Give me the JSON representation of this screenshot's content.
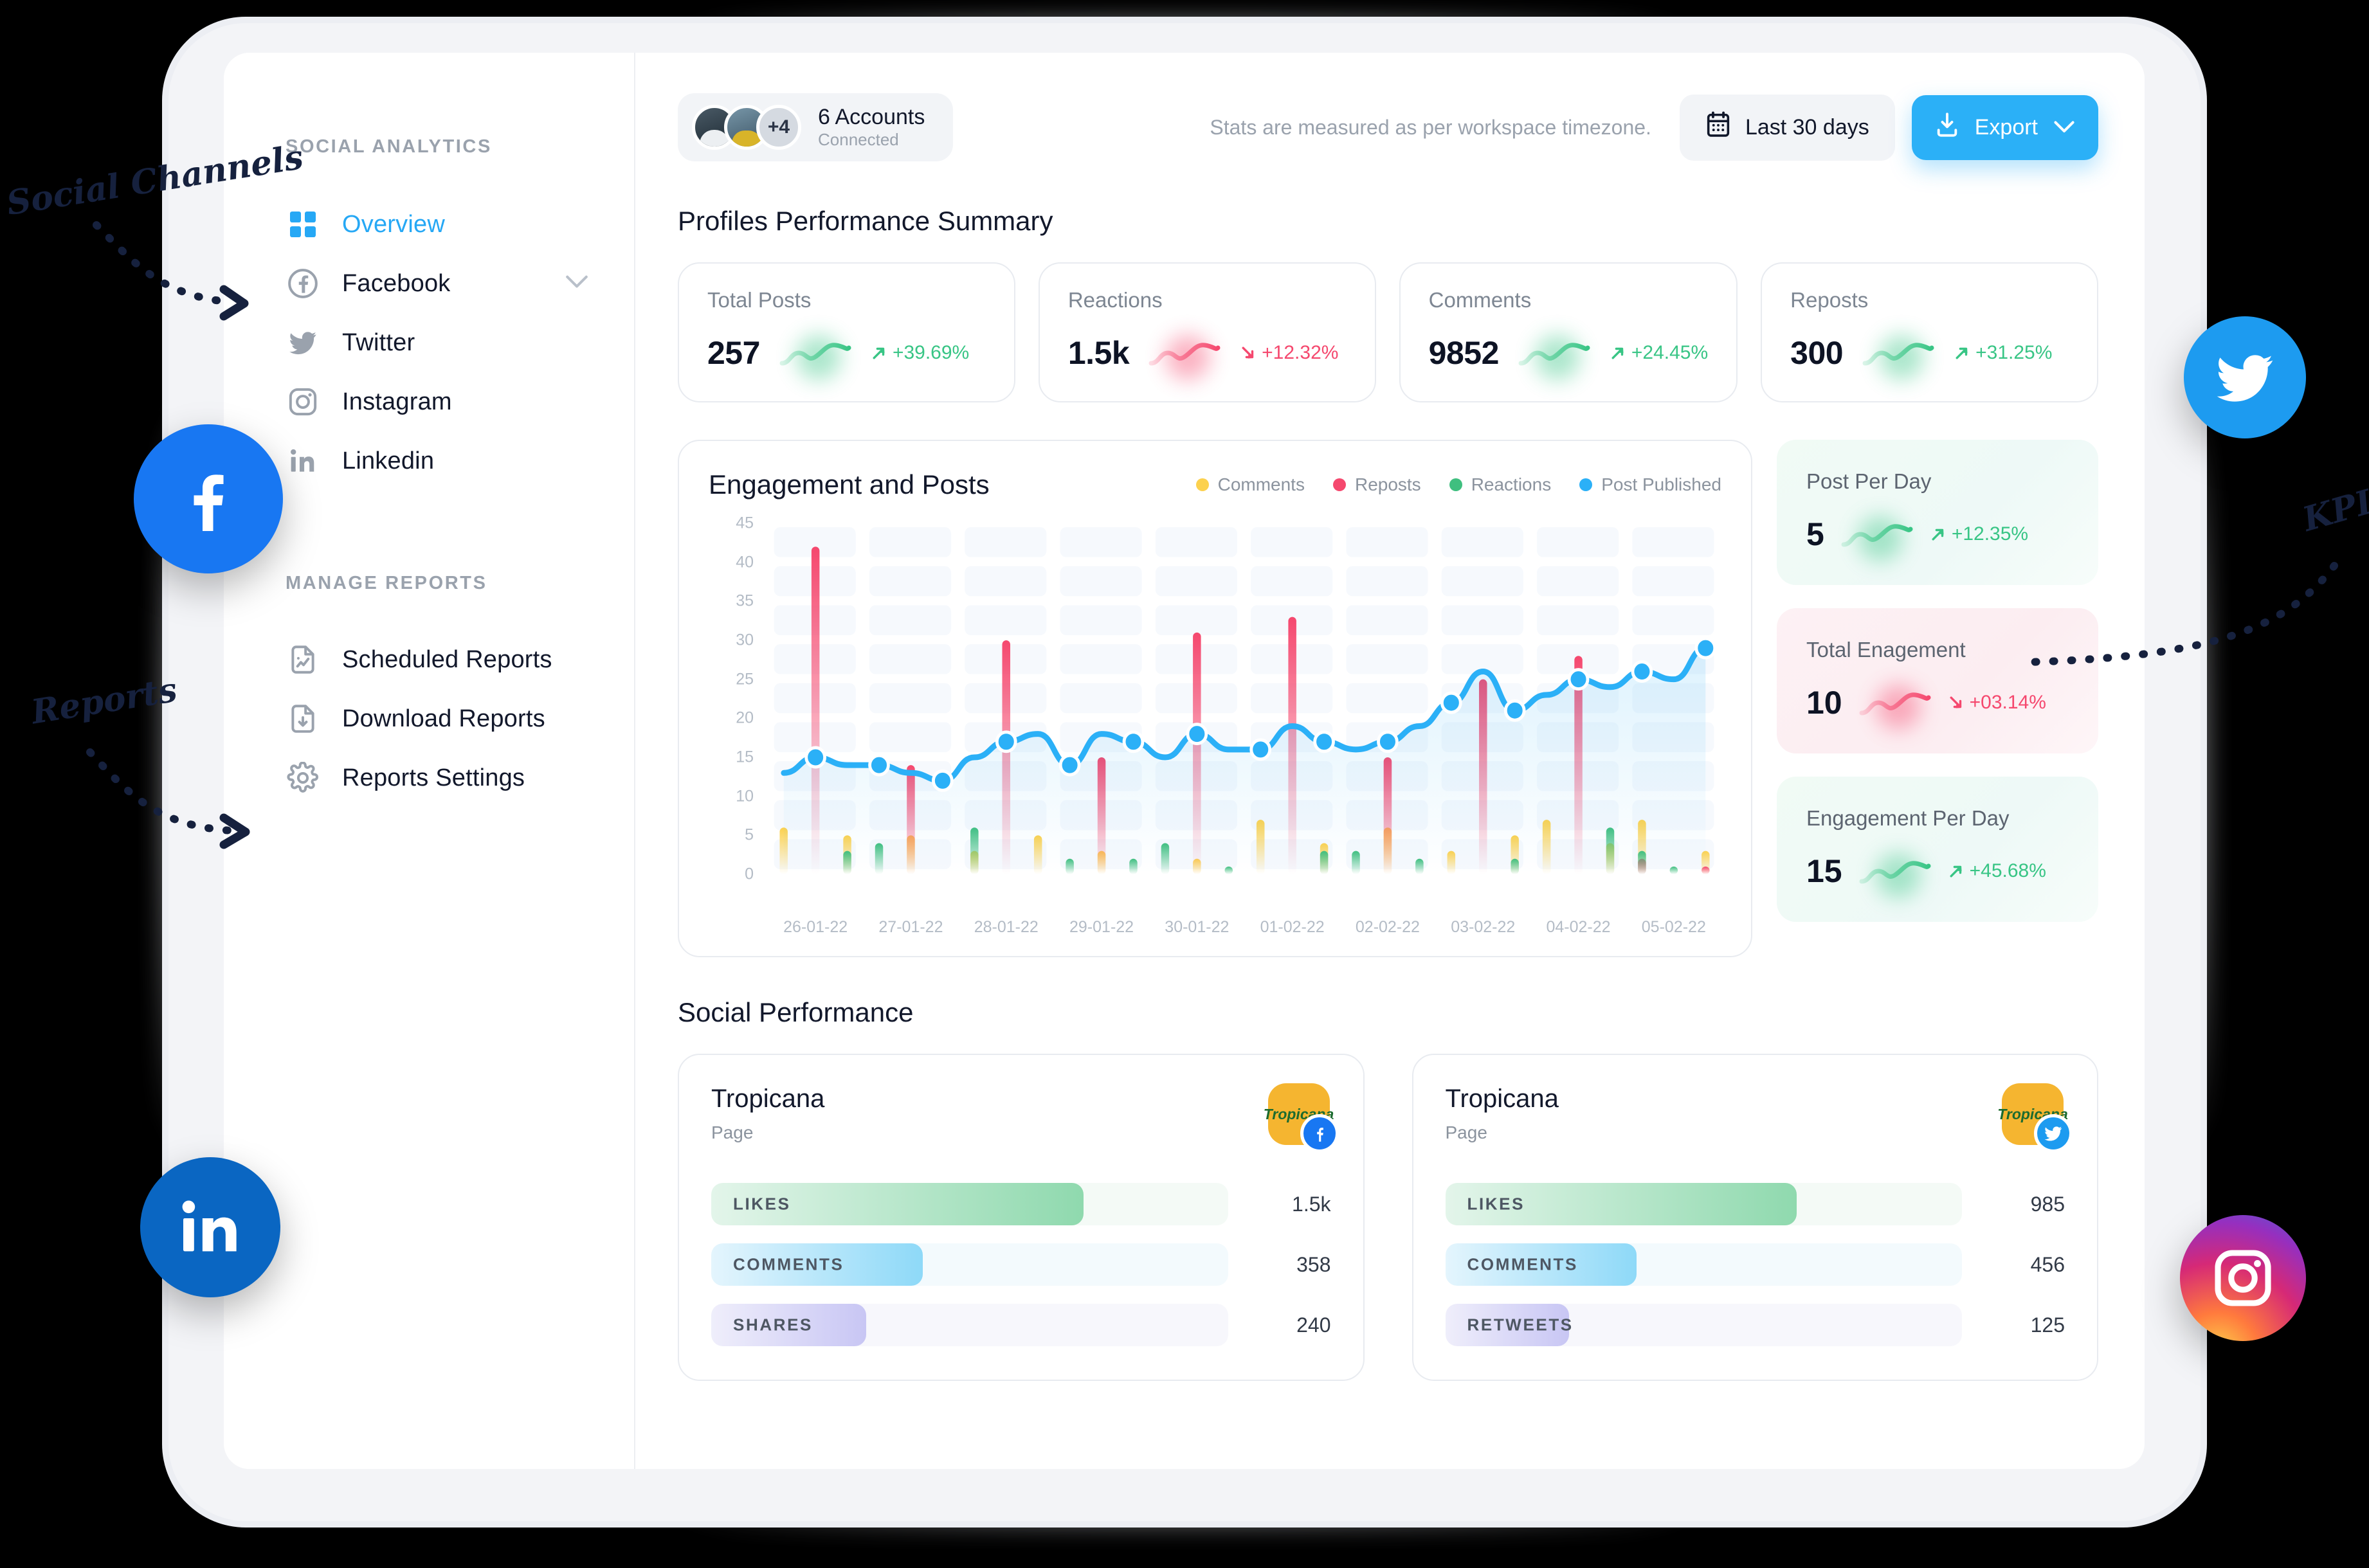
{
  "sidebar": {
    "section_social": "SOCIAL ANALYTICS",
    "section_reports": "MANAGE REPORTS",
    "social_items": [
      {
        "label": "Overview",
        "icon": "grid-icon"
      },
      {
        "label": "Facebook",
        "icon": "facebook-icon"
      },
      {
        "label": "Twitter",
        "icon": "twitter-icon"
      },
      {
        "label": "Instagram",
        "icon": "instagram-icon"
      },
      {
        "label": "Linkedin",
        "icon": "linkedin-icon"
      }
    ],
    "report_items": [
      {
        "label": "Scheduled Reports",
        "icon": "file-chart-icon"
      },
      {
        "label": "Download Reports",
        "icon": "file-download-icon"
      },
      {
        "label": "Reports Settings",
        "icon": "gear-icon"
      }
    ]
  },
  "topbar": {
    "accounts_count": "6 Accounts",
    "accounts_status": "Connected",
    "avatar_more": "+4",
    "timezone_note": "Stats are measured as per workspace timezone.",
    "date_range": "Last 30 days",
    "export_label": "Export"
  },
  "sections": {
    "profiles_summary": "Profiles Performance Summary",
    "social_performance": "Social Performance"
  },
  "kpis": [
    {
      "label": "Total Posts",
      "value": "257",
      "delta": "+39.69%",
      "dir": "up",
      "color": "#38c585"
    },
    {
      "label": "Reactions",
      "value": "1.5k",
      "delta": "+12.32%",
      "dir": "down",
      "color": "#f5486e"
    },
    {
      "label": "Comments",
      "value": "9852",
      "delta": "+24.45%",
      "dir": "up",
      "color": "#38c585"
    },
    {
      "label": "Reposts",
      "value": "300",
      "delta": "+31.25%",
      "dir": "up",
      "color": "#38c585"
    }
  ],
  "rail": [
    {
      "label": "Post Per Day",
      "value": "5",
      "delta": "+12.35%",
      "dir": "up",
      "theme": "green"
    },
    {
      "label": "Total Enagement",
      "value": "10",
      "delta": "+03.14%",
      "dir": "down",
      "theme": "pink"
    },
    {
      "label": "Engagement Per Day",
      "value": "15",
      "delta": "+45.68%",
      "dir": "up",
      "theme": "green"
    }
  ],
  "chart_data": {
    "type": "bar",
    "title": "Engagement and Posts",
    "xlabel": "",
    "ylabel": "",
    "ylim": [
      0,
      45
    ],
    "yticks": [
      0,
      5,
      10,
      15,
      20,
      25,
      30,
      35,
      40,
      45
    ],
    "grid": true,
    "legend_position": "top-right",
    "categories": [
      "26-01-22",
      "27-01-22",
      "28-01-22",
      "29-01-22",
      "30-01-22",
      "01-02-22",
      "02-02-22",
      "03-02-22",
      "04-02-22",
      "05-02-22"
    ],
    "x": [
      "26-01-22",
      "26-01-22",
      "26-01-22",
      "27-01-22",
      "27-01-22",
      "27-01-22",
      "28-01-22",
      "28-01-22",
      "28-01-22",
      "29-01-22",
      "29-01-22",
      "29-01-22",
      "30-01-22",
      "30-01-22",
      "30-01-22",
      "01-02-22",
      "01-02-22",
      "01-02-22",
      "02-02-22",
      "02-02-22",
      "02-02-22",
      "03-02-22",
      "03-02-22",
      "03-02-22",
      "04-02-22",
      "04-02-22",
      "04-02-22",
      "05-02-22",
      "05-02-22",
      "05-02-22"
    ],
    "series": [
      {
        "name": "Comments",
        "color": "#fcd14e",
        "values": [
          6,
          0,
          5,
          0,
          5,
          0,
          3,
          0,
          5,
          0,
          3,
          0,
          0,
          2,
          0,
          7,
          0,
          4,
          0,
          6,
          0,
          3,
          0,
          5,
          7,
          0,
          4,
          7,
          0,
          3
        ]
      },
      {
        "name": "Reposts",
        "color": "#f5486e",
        "values": [
          0,
          42,
          0,
          0,
          14,
          0,
          0,
          30,
          0,
          0,
          15,
          0,
          0,
          31,
          0,
          0,
          33,
          0,
          0,
          15,
          0,
          0,
          25,
          0,
          0,
          28,
          0,
          2,
          0,
          1
        ]
      },
      {
        "name": "Reactions",
        "color": "#3fbf7f",
        "values": [
          0,
          0,
          3,
          4,
          0,
          0,
          6,
          0,
          0,
          2,
          0,
          2,
          4,
          0,
          1,
          0,
          0,
          3,
          3,
          0,
          2,
          0,
          0,
          2,
          0,
          0,
          6,
          3,
          1,
          0
        ]
      },
      {
        "name": "Post Published",
        "color": "#2bb0f7",
        "type": "line",
        "values": [
          13,
          15,
          14,
          14,
          13,
          12,
          15,
          17,
          18,
          14,
          18,
          17,
          15,
          18,
          16,
          16,
          19,
          17,
          16,
          17,
          19,
          22,
          26,
          21,
          23,
          25,
          24,
          26,
          25,
          29
        ]
      }
    ]
  },
  "social_performance": [
    {
      "name": "Tropicana",
      "type": "Page",
      "network": "facebook",
      "brand_mark": "Tropicana",
      "metrics": [
        {
          "label": "LIKES",
          "value": "1.5k",
          "pct": 72,
          "color": "green"
        },
        {
          "label": "COMMENTS",
          "value": "358",
          "pct": 41,
          "color": "blue"
        },
        {
          "label": "SHARES",
          "value": "240",
          "pct": 30,
          "color": "purple"
        }
      ]
    },
    {
      "name": "Tropicana",
      "type": "Page",
      "network": "twitter",
      "brand_mark": "Tropicana",
      "metrics": [
        {
          "label": "LIKES",
          "value": "985",
          "pct": 68,
          "color": "green"
        },
        {
          "label": "COMMENTS",
          "value": "456",
          "pct": 37,
          "color": "blue"
        },
        {
          "label": "RETWEETS",
          "value": "125",
          "pct": 24,
          "color": "purple"
        }
      ]
    }
  ],
  "annotations": [
    {
      "text": "Social Channels",
      "target": "sidebar-social-nav"
    },
    {
      "text": "Reports",
      "target": "sidebar-reports-nav"
    },
    {
      "text": "KPIs",
      "target": "kpi-rail"
    }
  ],
  "floating_icons": [
    {
      "name": "facebook-icon",
      "color": "#1877f2"
    },
    {
      "name": "linkedin-icon",
      "color": "#0a66c2"
    },
    {
      "name": "twitter-icon",
      "color": "#1d9bf0"
    },
    {
      "name": "instagram-icon",
      "color": "#d62976"
    }
  ]
}
